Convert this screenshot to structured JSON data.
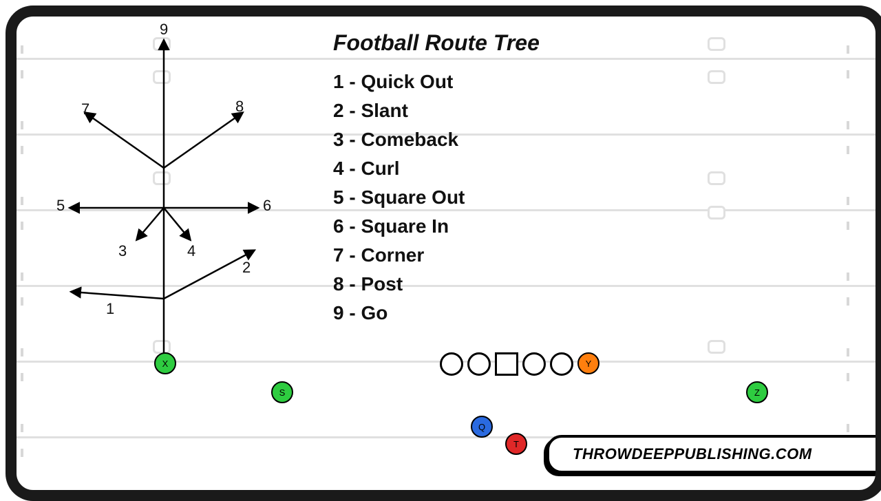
{
  "title": "Football Route Tree",
  "routes": [
    {
      "num": "1",
      "name": "Quick Out"
    },
    {
      "num": "2",
      "name": "Slant"
    },
    {
      "num": "3",
      "name": "Comeback"
    },
    {
      "num": "4",
      "name": "Curl"
    },
    {
      "num": "5",
      "name": "Square Out"
    },
    {
      "num": "6",
      "name": "Square In"
    },
    {
      "num": "7",
      "name": "Corner"
    },
    {
      "num": "8",
      "name": "Post"
    },
    {
      "num": "9",
      "name": "Go"
    }
  ],
  "credit": "THROWDEEPPUBLISHING.COM",
  "players": {
    "X": {
      "label": "X",
      "color": "#2ecc40"
    },
    "S": {
      "label": "S",
      "color": "#2ecc40"
    },
    "Z": {
      "label": "Z",
      "color": "#2ecc40"
    },
    "Y": {
      "label": "Y",
      "color": "#ff7f0e"
    },
    "Q": {
      "label": "Q",
      "color": "#2a6ae0"
    },
    "T": {
      "label": "T",
      "color": "#e02828"
    }
  },
  "numlabels": {
    "n1": "1",
    "n2": "2",
    "n3": "3",
    "n4": "4",
    "n5": "5",
    "n6": "6",
    "n7": "7",
    "n8": "8",
    "n9": "9"
  }
}
